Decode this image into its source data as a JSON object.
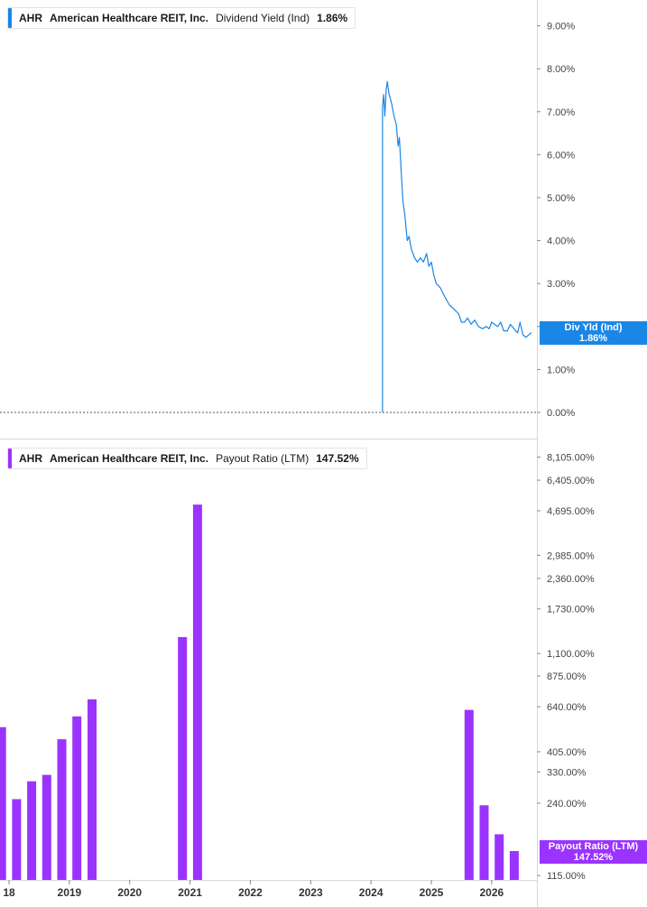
{
  "colors": {
    "yield": "#1a86e6",
    "payout": "#9b33ff",
    "axis_text": "#444444",
    "grid_line": "#d8d8d8"
  },
  "panels": {
    "top": {
      "ticker": "AHR",
      "company": "American Healthcare REIT, Inc.",
      "metric": "Dividend Yield (Ind)",
      "value": "1.86%",
      "badge_line1": "Div Yld (Ind)",
      "badge_line2": "1.86%"
    },
    "bottom": {
      "ticker": "AHR",
      "company": "American Healthcare REIT, Inc.",
      "metric": "Payout Ratio (LTM)",
      "value": "147.52%",
      "badge_line1": "Payout Ratio (LTM)",
      "badge_line2": "147.52%"
    }
  },
  "chart_data": [
    {
      "type": "line",
      "title": "Dividend Yield (Ind)",
      "ylim": [
        0,
        9.6
      ],
      "y_ticks": [
        0,
        1,
        2,
        3,
        4,
        5,
        6,
        7,
        8,
        9
      ],
      "y_tick_labels": [
        "0.00%",
        "1.00%",
        "",
        "3.00%",
        "4.00%",
        "5.00%",
        "6.00%",
        "7.00%",
        "8.00%",
        "9.00%"
      ],
      "xlim": [
        2017.85,
        2026.75
      ],
      "series": [
        {
          "points": [
            [
              2024.19,
              0.0
            ],
            [
              2024.19,
              7.1
            ],
            [
              2024.21,
              7.4
            ],
            [
              2024.23,
              6.9
            ],
            [
              2024.25,
              7.5
            ],
            [
              2024.27,
              7.7
            ],
            [
              2024.3,
              7.4
            ],
            [
              2024.34,
              7.2
            ],
            [
              2024.38,
              6.9
            ],
            [
              2024.42,
              6.7
            ],
            [
              2024.45,
              6.2
            ],
            [
              2024.47,
              6.4
            ],
            [
              2024.5,
              5.6
            ],
            [
              2024.53,
              4.9
            ],
            [
              2024.56,
              4.6
            ],
            [
              2024.6,
              4.0
            ],
            [
              2024.63,
              4.1
            ],
            [
              2024.67,
              3.8
            ],
            [
              2024.72,
              3.6
            ],
            [
              2024.77,
              3.5
            ],
            [
              2024.82,
              3.6
            ],
            [
              2024.87,
              3.5
            ],
            [
              2024.92,
              3.7
            ],
            [
              2024.96,
              3.4
            ],
            [
              2025.0,
              3.5
            ],
            [
              2025.04,
              3.2
            ],
            [
              2025.08,
              3.0
            ],
            [
              2025.15,
              2.9
            ],
            [
              2025.22,
              2.7
            ],
            [
              2025.3,
              2.5
            ],
            [
              2025.38,
              2.4
            ],
            [
              2025.45,
              2.3
            ],
            [
              2025.5,
              2.1
            ],
            [
              2025.55,
              2.1
            ],
            [
              2025.6,
              2.2
            ],
            [
              2025.66,
              2.05
            ],
            [
              2025.72,
              2.15
            ],
            [
              2025.78,
              2.0
            ],
            [
              2025.85,
              1.95
            ],
            [
              2025.91,
              2.0
            ],
            [
              2025.96,
              1.95
            ],
            [
              2026.0,
              2.1
            ],
            [
              2026.05,
              2.05
            ],
            [
              2026.1,
              2.0
            ],
            [
              2026.15,
              2.1
            ],
            [
              2026.2,
              1.9
            ],
            [
              2026.26,
              1.9
            ],
            [
              2026.31,
              2.05
            ],
            [
              2026.37,
              1.95
            ],
            [
              2026.43,
              1.85
            ],
            [
              2026.47,
              2.1
            ],
            [
              2026.52,
              1.8
            ],
            [
              2026.57,
              1.75
            ],
            [
              2026.61,
              1.8
            ],
            [
              2026.66,
              1.86
            ]
          ]
        }
      ]
    },
    {
      "type": "bar",
      "title": "Payout Ratio (LTM)",
      "y_scale": "log",
      "ylim": [
        110,
        9600
      ],
      "y_ticks": [
        115,
        240,
        330,
        405,
        640,
        875,
        1100,
        1730,
        2360,
        2985,
        4695,
        6405,
        8105
      ],
      "y_tick_labels": [
        "115.00%",
        "240.00%",
        "330.00%",
        "405.00%",
        "640.00%",
        "875.00%",
        "1,100.00%",
        "1,730.00%",
        "2,360.00%",
        "2,985.00%",
        "4,695.00%",
        "6,405.00%",
        "8,105.00%"
      ],
      "xlim": [
        2017.85,
        2026.75
      ],
      "x_ticks": [
        2018,
        2019,
        2020,
        2021,
        2022,
        2023,
        2024,
        2025,
        2026
      ],
      "x_tick_labels": [
        "18",
        "2019",
        "2020",
        "2021",
        "2022",
        "2023",
        "2024",
        "2025",
        "2026"
      ],
      "bars": [
        {
          "x": 2017.875,
          "value": 520
        },
        {
          "x": 2018.125,
          "value": 250
        },
        {
          "x": 2018.375,
          "value": 300
        },
        {
          "x": 2018.625,
          "value": 320
        },
        {
          "x": 2018.875,
          "value": 460
        },
        {
          "x": 2019.125,
          "value": 580
        },
        {
          "x": 2019.375,
          "value": 690
        },
        {
          "x": 2020.875,
          "value": 1300
        },
        {
          "x": 2021.125,
          "value": 5000
        },
        {
          "x": 2025.625,
          "value": 620
        },
        {
          "x": 2025.875,
          "value": 235
        },
        {
          "x": 2026.125,
          "value": 175
        },
        {
          "x": 2026.375,
          "value": 147.52
        }
      ]
    }
  ]
}
